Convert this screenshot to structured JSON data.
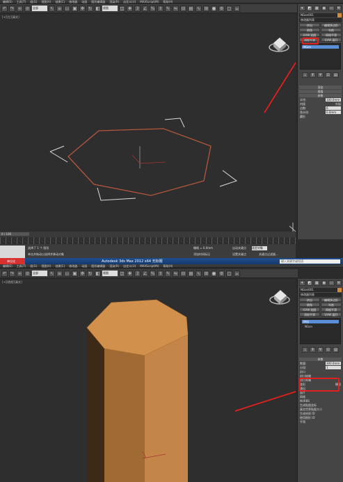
{
  "top": {
    "menu": [
      "编辑(E)",
      "工具(T)",
      "组(G)",
      "视图(V)",
      "创建(C)",
      "修改器",
      "动画",
      "图形编辑器",
      "渲染(R)",
      "自定义(U)",
      "MAXScript(M)",
      "帮助(H)"
    ],
    "select_filter": "全部",
    "view_select": "视图",
    "viewport_label": "[+][左][真实]",
    "panel": {
      "object_name": "NGon001",
      "modifier_list": "修改器列表",
      "buttons": [
        "挤出",
        "编辑多边形",
        "倒角",
        "车削",
        "UVW 贴图",
        "网格平滑",
        "涡轮平滑",
        "UVW 展开"
      ],
      "stack_item": "NGon",
      "rollouts": [
        "渲染",
        "插值",
        "参数"
      ],
      "params": {
        "radius_label": "半径:",
        "radius": "100.0mm",
        "inscribed": "内接",
        "circumscribed": "外接",
        "sides_label": "边数:",
        "sides": "6",
        "corner_label": "角半径:",
        "corner": "0.0mm",
        "circular": "圆形"
      }
    },
    "timeline": {
      "frame": "0 / 100"
    },
    "status": {
      "selected": "选择了 1 个 图形",
      "hint": "单击并拖动以选择并移动对象",
      "grid": "栅格 = 0.0mm",
      "autokey": "自动关键点",
      "setkey": "设置关键点",
      "selected_dropdown": "选定对象",
      "filter": "关键点过滤器...",
      "addtime": "添加时间标记"
    }
  },
  "taskbar": {
    "start_label": "单位化",
    "title": "Autodesk 3ds Max 2012 x64   无标题",
    "search": "键入关键字或短语"
  },
  "bottom": {
    "menu": [
      "编辑(E)",
      "工具(T)",
      "组(G)",
      "视图(V)",
      "创建(C)",
      "修改器",
      "动画",
      "图形编辑器",
      "渲染(R)",
      "自定义(U)",
      "MAXScript(M)",
      "帮助(H)"
    ],
    "select_filter": "全部",
    "view_select": "视图",
    "viewport_label": "[+][透视][真实]",
    "panel": {
      "object_name": "NGon001",
      "modifier_list": "修改器列表",
      "buttons": [
        "挤出",
        "编辑多边形",
        "倒角",
        "车削",
        "UVW 贴图",
        "网格平滑",
        "涡轮平滑",
        "UVW 展开"
      ],
      "stack_items": [
        "挤出",
        "NGon"
      ],
      "rollout": "参数",
      "amount_label": "数量:",
      "amount": "300.0mm",
      "segments_label": "分段:",
      "segments": "1",
      "capping_title": "封口",
      "cap_start": "封口始端",
      "cap_end": "封口末端",
      "morph": "变形",
      "grid_opt": "栅格",
      "output_title": "输出",
      "patch": "面片",
      "mesh": "网格",
      "nurbs": "NURBS",
      "gen_coords": "生成贴图坐标",
      "real_world": "真实世界贴图大小",
      "gen_mat": "生成材质 ID",
      "use_shape": "使用图形 ID",
      "smooth": "平滑"
    }
  },
  "colors": {
    "annotation": "#e0201e",
    "extrude_fill": "#d1914d",
    "ngon_stroke": "#b5583b"
  }
}
